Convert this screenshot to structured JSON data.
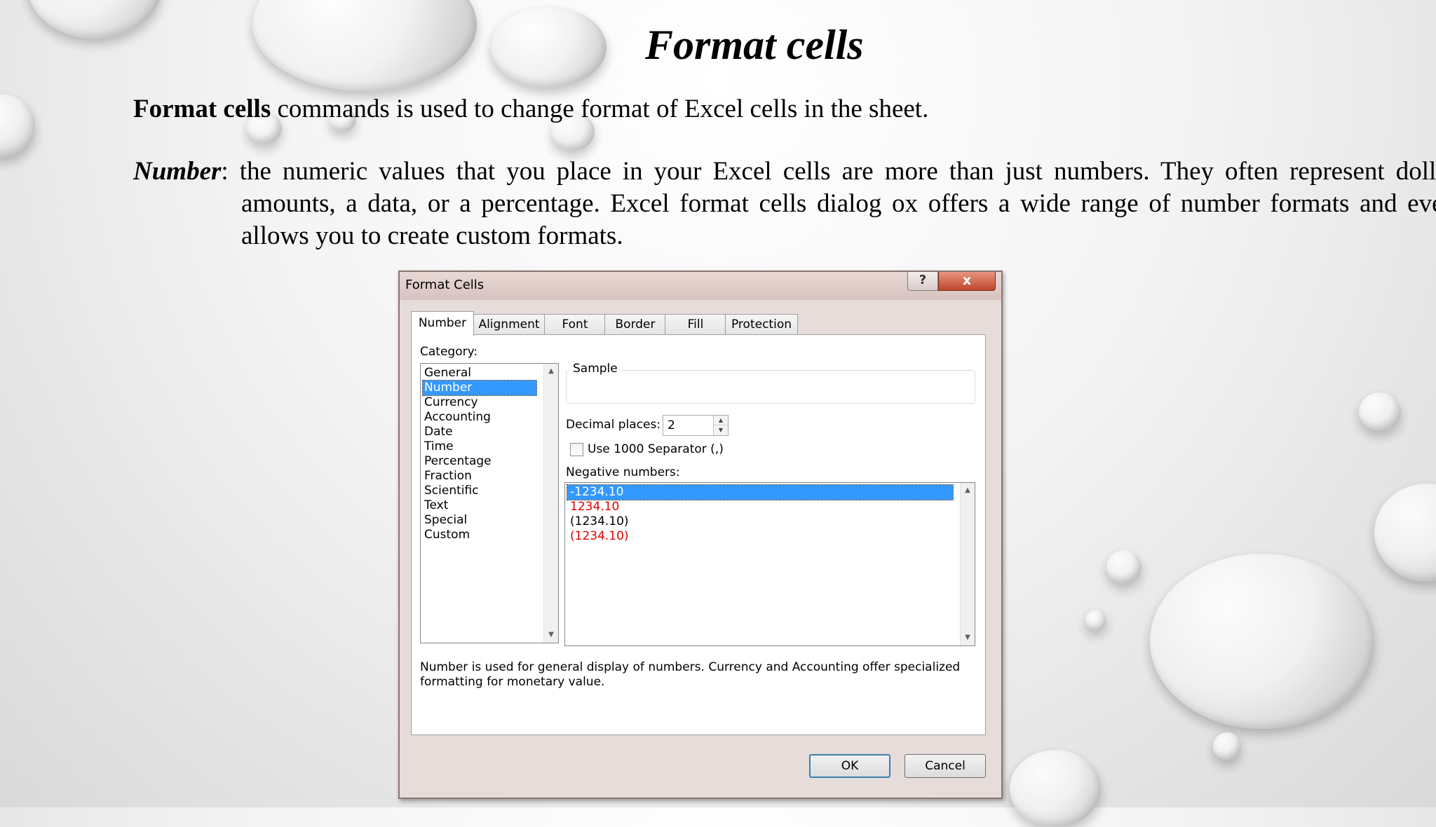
{
  "slide": {
    "title": "Format cells",
    "para1_bold": "Format cells",
    "para1_rest": " commands is used to change format of Excel cells in the sheet.",
    "para2_term": "Number",
    "para2_rest": ": the numeric values that you place in your Excel cells are more than just numbers. They often represent dollar amounts, a data, or a percentage. Excel format cells dialog ox offers a wide range of number formats and even allows you to create custom formats."
  },
  "dialog": {
    "title": "Format Cells",
    "help_glyph": "?",
    "close_glyph": "x",
    "tabs": [
      "Number",
      "Alignment",
      "Font",
      "Border",
      "Fill",
      "Protection"
    ],
    "category_label": "Category:",
    "categories": [
      "General",
      "Number",
      "Currency",
      "Accounting",
      "Date",
      "Time",
      "Percentage",
      "Fraction",
      "Scientific",
      "Text",
      "Special",
      "Custom"
    ],
    "selected_category": "Number",
    "sample_label": "Sample",
    "decimal_label": "Decimal places:",
    "decimal_value": "2",
    "separator_label": "Use 1000 Separator (,)",
    "separator_checked": false,
    "negative_label": "Negative numbers:",
    "negative_numbers": [
      "-1234.10",
      "1234.10",
      "(1234.10)",
      "(1234.10)"
    ],
    "description": "Number is used for general display of numbers.  Currency and Accounting offer specialized formatting for monetary value.",
    "ok_label": "OK",
    "cancel_label": "Cancel",
    "colors": {
      "selection": "#3399ff",
      "negative_red": "#e00000",
      "titlebar": "#d7c3bf"
    }
  }
}
